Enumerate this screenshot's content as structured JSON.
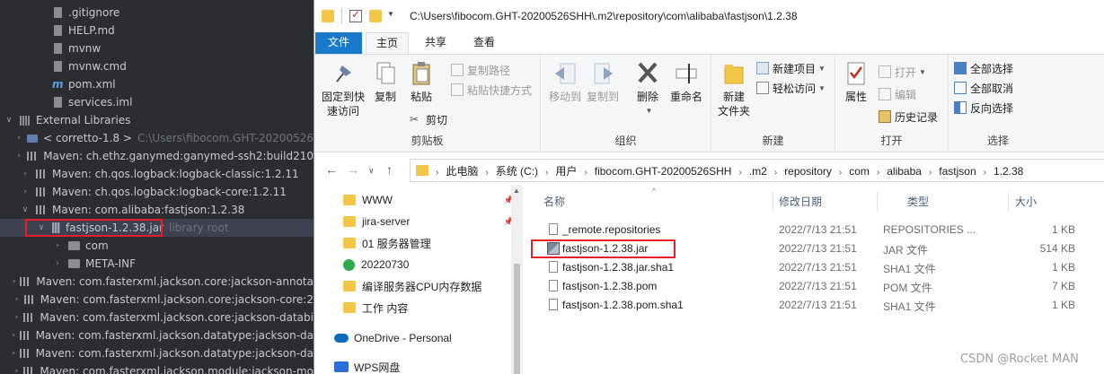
{
  "ide": {
    "tree": [
      {
        "label": ".gitignore",
        "icon": "file-icon",
        "indent": 2,
        "expander": ""
      },
      {
        "label": "HELP.md",
        "icon": "file-icon",
        "indent": 2,
        "expander": ""
      },
      {
        "label": "mvnw",
        "icon": "file-icon",
        "indent": 2,
        "expander": ""
      },
      {
        "label": "mvnw.cmd",
        "icon": "file-icon",
        "indent": 2,
        "expander": ""
      },
      {
        "label": "pom.xml",
        "icon": "maven-icon",
        "indent": 2,
        "expander": ""
      },
      {
        "label": "services.iml",
        "icon": "file-icon",
        "indent": 2,
        "expander": ""
      },
      {
        "label": "External Libraries",
        "icon": "library-icon",
        "indent": 0,
        "expander": "expanded"
      },
      {
        "label": "< corretto-1.8 >",
        "suffix": "C:\\Users\\fibocom.GHT-20200526",
        "icon": "jdk-icon",
        "indent": 1,
        "expander": "collapsed"
      },
      {
        "label": "Maven: ch.ethz.ganymed:ganymed-ssh2:build210",
        "icon": "bars-icon",
        "indent": 1,
        "expander": "collapsed"
      },
      {
        "label": "Maven: ch.qos.logback:logback-classic:1.2.11",
        "icon": "bars-icon",
        "indent": 1,
        "expander": "collapsed"
      },
      {
        "label": "Maven: ch.qos.logback:logback-core:1.2.11",
        "icon": "bars-icon",
        "indent": 1,
        "expander": "collapsed"
      },
      {
        "label": "Maven: com.alibaba:fastjson:1.2.38",
        "icon": "bars-icon",
        "indent": 1,
        "expander": "expanded"
      },
      {
        "label": "fastjson-1.2.38.jar",
        "suffix": "library root",
        "icon": "jar-icon",
        "indent": 2,
        "expander": "expanded",
        "selected": true
      },
      {
        "label": "com",
        "icon": "folder-icon",
        "indent": 3,
        "expander": "collapsed"
      },
      {
        "label": "META-INF",
        "icon": "folder-icon",
        "indent": 3,
        "expander": "collapsed"
      },
      {
        "label": "Maven: com.fasterxml.jackson.core:jackson-annota",
        "icon": "bars-icon",
        "indent": 1,
        "expander": "collapsed"
      },
      {
        "label": "Maven: com.fasterxml.jackson.core:jackson-core:2",
        "icon": "bars-icon",
        "indent": 1,
        "expander": "collapsed"
      },
      {
        "label": "Maven: com.fasterxml.jackson.core:jackson-databi",
        "icon": "bars-icon",
        "indent": 1,
        "expander": "collapsed"
      },
      {
        "label": "Maven: com.fasterxml.jackson.datatype:jackson-da",
        "icon": "bars-icon",
        "indent": 1,
        "expander": "collapsed"
      },
      {
        "label": "Maven: com.fasterxml.jackson.datatype:jackson-da",
        "icon": "bars-icon",
        "indent": 1,
        "expander": "collapsed"
      },
      {
        "label": "Maven: com.fasterxml.jackson.module:jackson-mo",
        "icon": "bars-icon",
        "indent": 1,
        "expander": "collapsed"
      }
    ]
  },
  "explorer": {
    "title_path": "C:\\Users\\fibocom.GHT-20200526SHH\\.m2\\repository\\com\\alibaba\\fastjson\\1.2.38",
    "tabs": {
      "file": "文件",
      "home": "主页",
      "share": "共享",
      "view": "查看"
    },
    "ribbon": {
      "clipboard": {
        "label": "剪贴板",
        "pin": "固定到快\n速访问",
        "copy": "复制",
        "paste": "粘贴",
        "copy_path": "复制路径",
        "paste_shortcut": "粘贴快捷方式",
        "cut": "剪切"
      },
      "organize": {
        "label": "组织",
        "move_to": "移动到",
        "copy_to": "复制到",
        "delete": "删除",
        "rename": "重命名"
      },
      "new": {
        "label": "新建",
        "new_folder": "新建\n文件夹",
        "new_item": "新建项目",
        "easy_access": "轻松访问"
      },
      "open": {
        "label": "打开",
        "properties": "属性",
        "open": "打开",
        "edit": "编辑",
        "history": "历史记录"
      },
      "select": {
        "label": "选择",
        "select_all": "全部选择",
        "select_none": "全部取消",
        "invert": "反向选择"
      }
    },
    "address": [
      "此电脑",
      "系统 (C:)",
      "用户",
      "fibocom.GHT-20200526SHH",
      ".m2",
      "repository",
      "com",
      "alibaba",
      "fastjson",
      "1.2.38"
    ],
    "nav": [
      {
        "label": "WWW",
        "pinned": true
      },
      {
        "label": "jira-server",
        "pinned": true
      },
      {
        "label": "01 服务器管理",
        "pinned": false
      },
      {
        "label": "20220730",
        "pinned": false,
        "check": true
      },
      {
        "label": "编译服务器CPU内存数据",
        "pinned": false
      },
      {
        "label": "工作 内容",
        "pinned": false
      }
    ],
    "onedrive": "OneDrive - Personal",
    "wps": "WPS网盘",
    "columns": {
      "name": "名称",
      "date": "修改日期",
      "type": "类型",
      "size": "大小"
    },
    "files": [
      {
        "name": "_remote.repositories",
        "date": "2022/7/13 21:51",
        "type": "REPOSITORIES ...",
        "size": "1 KB"
      },
      {
        "name": "fastjson-1.2.38.jar",
        "date": "2022/7/13 21:51",
        "type": "JAR 文件",
        "size": "514 KB",
        "jar": true
      },
      {
        "name": "fastjson-1.2.38.jar.sha1",
        "date": "2022/7/13 21:51",
        "type": "SHA1 文件",
        "size": "1 KB"
      },
      {
        "name": "fastjson-1.2.38.pom",
        "date": "2022/7/13 21:51",
        "type": "POM 文件",
        "size": "7 KB"
      },
      {
        "name": "fastjson-1.2.38.pom.sha1",
        "date": "2022/7/13 21:51",
        "type": "SHA1 文件",
        "size": "1 KB"
      }
    ]
  },
  "watermark": "CSDN @Rocket MAN",
  "colors": {
    "ide_bg": "#2b2d30",
    "highlight": "#e5202b",
    "file_tab": "#1979ca",
    "folder": "#f3c64a"
  }
}
